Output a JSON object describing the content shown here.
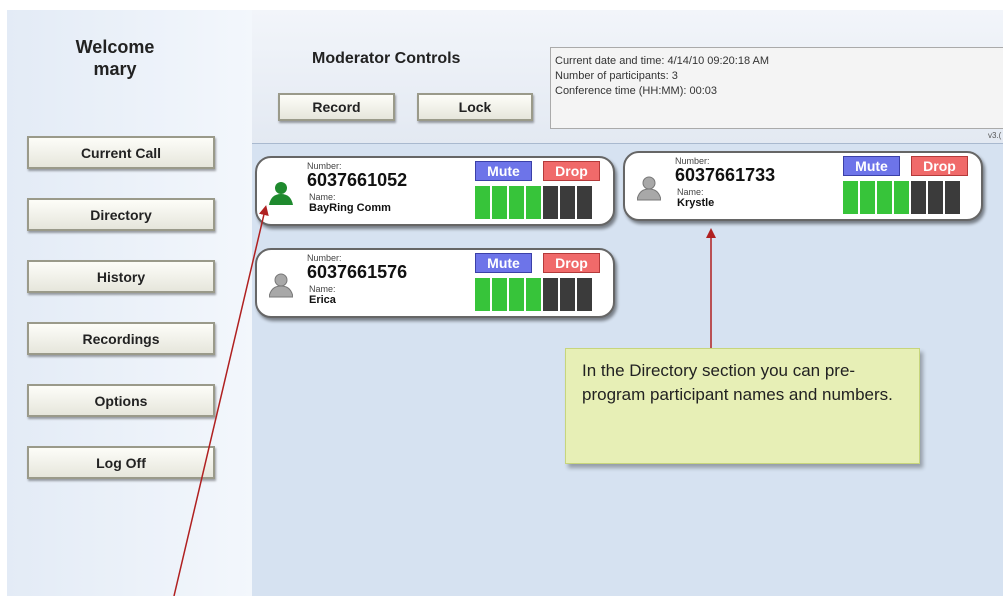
{
  "sidebar": {
    "welcome_line1": "Welcome",
    "welcome_line2": "mary",
    "items": [
      {
        "label": "Current Call"
      },
      {
        "label": "Directory"
      },
      {
        "label": "History"
      },
      {
        "label": "Recordings"
      },
      {
        "label": "Options"
      },
      {
        "label": "Log Off"
      }
    ]
  },
  "header": {
    "title": "Moderator Controls",
    "record_label": "Record",
    "lock_label": "Lock",
    "info": {
      "date_line": "Current date and time:  4/14/10 09:20:18 AM",
      "participants_line": "Number of participants: 3",
      "conference_line": "Conference time (HH:MM):  00:03"
    },
    "version": "v3.("
  },
  "participants": [
    {
      "number_label": "Number:",
      "number": "6037661052",
      "name_label": "Name:",
      "name": "BayRing Comm",
      "mute_label": "Mute",
      "drop_label": "Drop",
      "active": true,
      "level_bars": 4,
      "total_bars": 7
    },
    {
      "number_label": "Number:",
      "number": "6037661733",
      "name_label": "Name:",
      "name": "Krystle",
      "mute_label": "Mute",
      "drop_label": "Drop",
      "active": false,
      "level_bars": 4,
      "total_bars": 7
    },
    {
      "number_label": "Number:",
      "number": "6037661576",
      "name_label": "Name:",
      "name": "Erica",
      "mute_label": "Mute",
      "drop_label": "Drop",
      "active": false,
      "level_bars": 4,
      "total_bars": 7
    }
  ],
  "callout": {
    "text": "In the Directory section you can pre-program participant names and numbers."
  },
  "colors": {
    "mute": "#6d74e9",
    "drop": "#f06a6a",
    "meter_on": "#37c43a",
    "meter_off": "#3b3b3b",
    "active_person": "#1f8a2e",
    "inactive_person": "#9a9a9a",
    "arrow": "#b02020"
  }
}
